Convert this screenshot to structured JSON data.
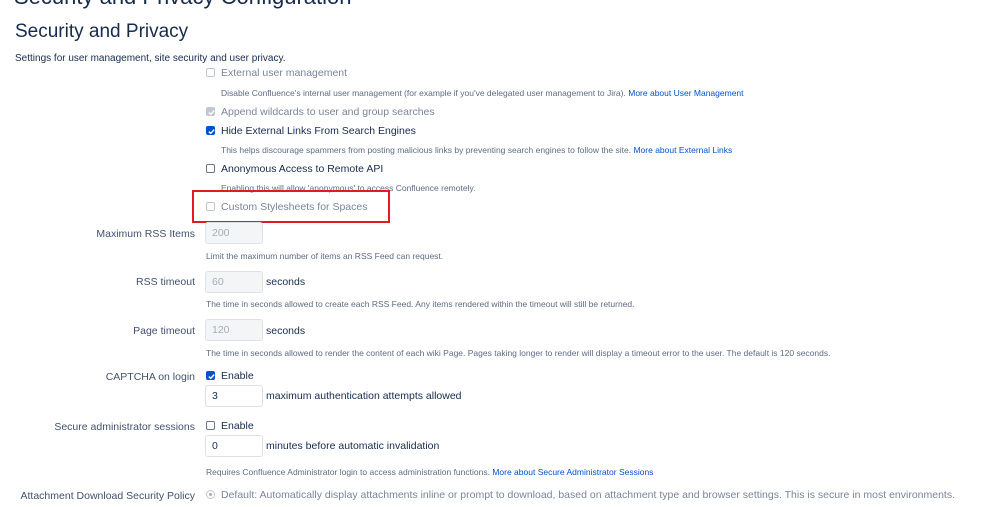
{
  "page": {
    "cropped_title": "Security and Privacy Configuration",
    "section_title": "Security and Privacy",
    "intro": "Settings for user management, site security and user privacy."
  },
  "options": {
    "external_user_mgmt": {
      "label": "External user management",
      "checked": false,
      "disabled": true,
      "description": "Disable Confluence's internal user management (for example if you've delegated user management to Jira).",
      "link": "More about User Management"
    },
    "append_wildcards": {
      "label": "Append wildcards to user and group searches",
      "checked": true,
      "disabled": true
    },
    "hide_external_links": {
      "label": "Hide External Links From Search Engines",
      "checked": true,
      "description": "This helps discourage spammers from posting malicious links by preventing search engines to follow the site.",
      "link": "More about External Links"
    },
    "anonymous_remote_api": {
      "label": "Anonymous Access to Remote API",
      "checked": false,
      "description": "Enabling this will allow 'anonymous' to access Confluence remotely."
    },
    "custom_stylesheets": {
      "label": "Custom Stylesheets for Spaces",
      "checked": false,
      "disabled": true
    }
  },
  "fields": {
    "max_rss": {
      "label": "Maximum RSS Items",
      "value": "200",
      "description": "Limit the maximum number of items an RSS Feed can request."
    },
    "rss_timeout": {
      "label": "RSS timeout",
      "value": "60",
      "unit": "seconds",
      "description": "The time in seconds allowed to create each RSS Feed. Any items rendered within the timeout will still be returned."
    },
    "page_timeout": {
      "label": "Page timeout",
      "value": "120",
      "unit": "seconds",
      "description": "The time in seconds allowed to render the content of each wiki Page. Pages taking longer to render will display a timeout error to the user. The default is 120 seconds."
    },
    "captcha": {
      "label": "CAPTCHA on login",
      "enable_label": "Enable",
      "checked": true,
      "attempts_value": "3",
      "attempts_unit": "maximum authentication attempts allowed"
    },
    "secure_admin": {
      "label": "Secure administrator sessions",
      "enable_label": "Enable",
      "checked": false,
      "minutes_value": "0",
      "minutes_unit": "minutes before automatic invalidation",
      "description": "Requires Confluence Administrator login to access administration functions.",
      "link": "More about Secure Administrator Sessions"
    },
    "attachment_policy": {
      "label": "Attachment Download Security Policy",
      "option_label": "Default: Automatically display attachments inline or prompt to download, based on attachment type and browser settings. This is secure in most environments."
    }
  },
  "colors": {
    "accent": "#0052cc",
    "highlight": "#e01b24",
    "text": "#172b4d"
  }
}
